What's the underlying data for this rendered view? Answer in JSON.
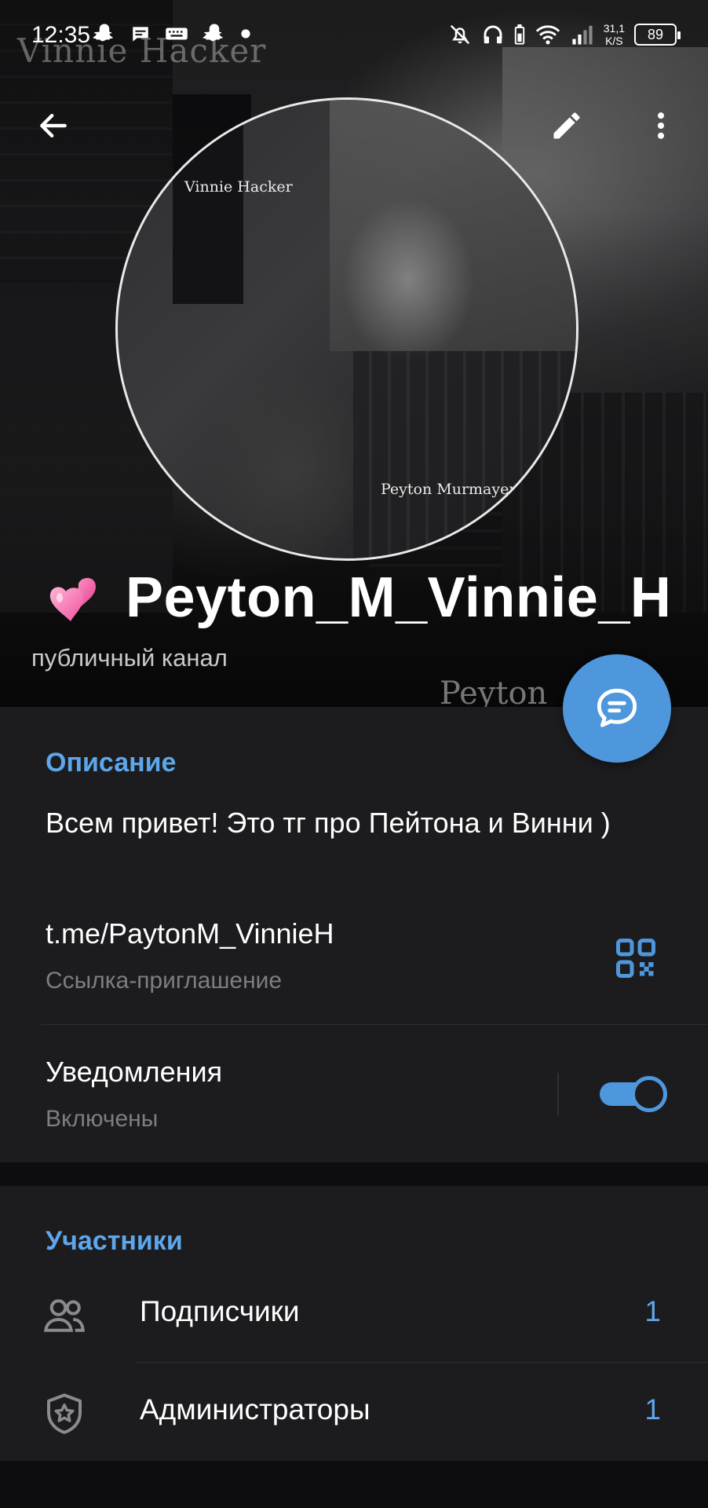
{
  "status_bar": {
    "time": "12:35",
    "speed_value": "31,1",
    "speed_unit": "K/S",
    "battery": "89"
  },
  "cover": {
    "watermark_top": "Vinnie  Hacker",
    "watermark_bottom": "Peyton Murmayer",
    "avatar_caption_1": "Vinnie  Hacker",
    "avatar_caption_2": "Peyton Murmayer"
  },
  "channel": {
    "name": "Peyton_M_Vinnie_H",
    "type": "публичный канал"
  },
  "info": {
    "description_header": "Описание",
    "description_text": "Всем привет! Это тг про Пейтона и Винни )",
    "link": "t.me/PaytonM_VinnieH",
    "link_subtitle": "Ссылка-приглашение",
    "notifications_label": "Уведомления",
    "notifications_state": "Включены",
    "notifications_on": true
  },
  "members": {
    "header": "Участники",
    "rows": [
      {
        "label": "Подписчики",
        "count": "1",
        "icon": "people-icon"
      },
      {
        "label": "Администраторы",
        "count": "1",
        "icon": "shield-star-icon"
      }
    ]
  },
  "colors": {
    "accent": "#4e97dc",
    "section_bg": "#1c1c1f",
    "page_bg": "#0d0d0f",
    "secondary_text": "#7d7d82"
  }
}
